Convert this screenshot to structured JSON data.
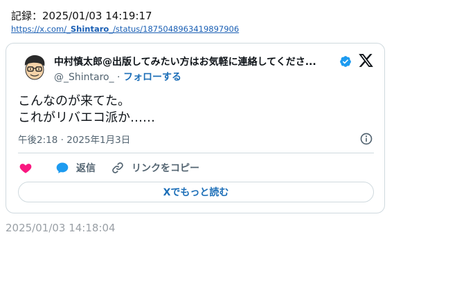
{
  "record": {
    "title": "記録：2025/01/03 14:19:17",
    "link_prefix": "https://x.com/",
    "link_user": "_Shintaro_",
    "link_suffix": "/status/1875048963419897906"
  },
  "tweet": {
    "author_name": "中村慎太郎@出版してみたい方はお気軽に連絡してくださ...",
    "handle": "@_Shintaro_",
    "separator": " · ",
    "follow_label": "フォローする",
    "text_lines": [
      "こんなのが来てた。",
      "これがリバエコ派か……"
    ],
    "timestamp": "午後2:18 · 2025年1月3日",
    "actions": {
      "reply_label": "返信",
      "copy_link_label": "リンクをコピー"
    },
    "read_more_label": "Xでもっと読む"
  },
  "footer": {
    "saved_time": "2025/01/03 14:18:04"
  },
  "colors": {
    "link": "#1d6fb8",
    "like": "#f91880",
    "reply": "#1d9bf0",
    "verified": "#1d9bf0",
    "border": "#cfd9de",
    "muted": "#536471"
  },
  "icons": [
    "avatar",
    "verified-badge-icon",
    "x-logo-icon",
    "info-icon",
    "heart-icon",
    "reply-bubble-icon",
    "link-icon"
  ]
}
